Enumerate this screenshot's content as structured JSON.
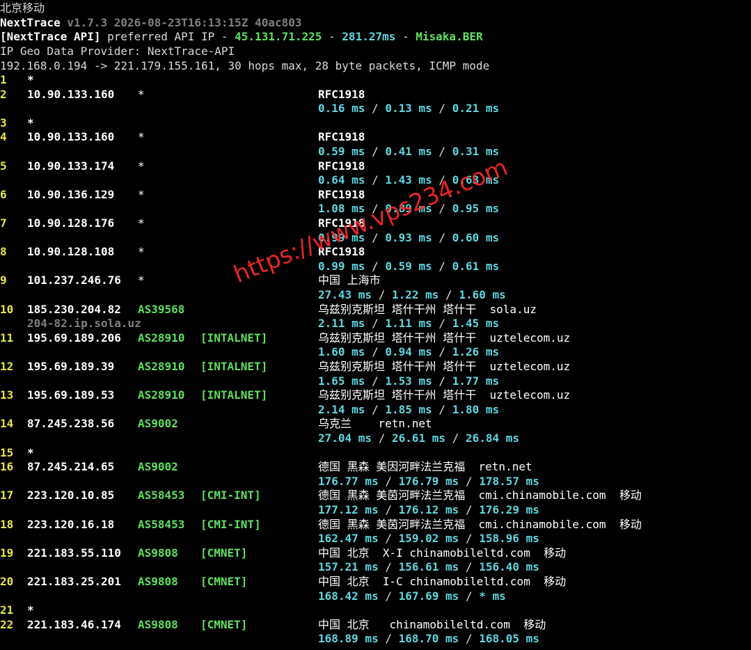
{
  "header": {
    "title_line": "北京移动",
    "app_name": "NextTrace",
    "version": "v1.7.3 2026-08-23T16:13:15Z 40ac803",
    "api_prefix": "[NextTrace API]",
    "api_mid": " preferred API IP - ",
    "api_ip": "45.131.71.225",
    "api_dash1": " - ",
    "api_latency": "281.27ms",
    "api_dash2": " - ",
    "api_node": "Misaka.BER",
    "geo_provider": "IP Geo Data Provider: NextTrace-API",
    "trace_summary": "192.168.0.194 -> 221.179.155.161, 30 hops max, 28 byte packets, ICMP mode"
  },
  "hops": [
    {
      "n": "1",
      "ip": "*"
    },
    {
      "n": "2",
      "ip": "10.90.133.160",
      "asn": "*",
      "geo": "RFC1918",
      "lat": [
        "0.16 ms",
        "0.13 ms",
        "0.21 ms"
      ]
    },
    {
      "n": "3",
      "ip": "*"
    },
    {
      "n": "4",
      "ip": "10.90.133.160",
      "asn": "*",
      "geo": "RFC1918",
      "lat": [
        "0.59 ms",
        "0.41 ms",
        "0.31 ms"
      ]
    },
    {
      "n": "5",
      "ip": "10.90.133.174",
      "asn": "*",
      "geo": "RFC1918",
      "lat": [
        "0.64 ms",
        "1.43 ms",
        "0.63 ms"
      ]
    },
    {
      "n": "6",
      "ip": "10.90.136.129",
      "asn": "*",
      "geo": "RFC1918",
      "lat": [
        "1.08 ms",
        "0.89 ms",
        "0.95 ms"
      ]
    },
    {
      "n": "7",
      "ip": "10.90.128.176",
      "asn": "*",
      "geo": "RFC1918",
      "lat": [
        "0.99 ms",
        "0.93 ms",
        "0.60 ms"
      ]
    },
    {
      "n": "8",
      "ip": "10.90.128.108",
      "asn": "*",
      "geo": "RFC1918",
      "lat": [
        "0.99 ms",
        "0.59 ms",
        "0.61 ms"
      ]
    },
    {
      "n": "9",
      "ip": "101.237.246.76",
      "asn": "*",
      "geo": "中国 上海市",
      "lat": [
        "27.43 ms",
        "1.22 ms",
        "1.60 ms"
      ]
    },
    {
      "n": "10",
      "ip": "185.230.204.82",
      "asn": "AS39568",
      "geo": "乌兹别克斯坦 塔什干州 塔什干  sola.uz",
      "rdns": "204-82.ip.sola.uz",
      "lat": [
        "2.11 ms",
        "1.11 ms",
        "1.45 ms"
      ]
    },
    {
      "n": "11",
      "ip": "195.69.189.206",
      "asn": "AS28910",
      "tag": "[INTALNET]",
      "geo": "乌兹别克斯坦 塔什干州 塔什干  uztelecom.uz",
      "lat": [
        "1.60 ms",
        "0.94 ms",
        "1.26 ms"
      ]
    },
    {
      "n": "12",
      "ip": "195.69.189.39",
      "asn": "AS28910",
      "tag": "[INTALNET]",
      "geo": "乌兹别克斯坦 塔什干州 塔什干  uztelecom.uz",
      "lat": [
        "1.65 ms",
        "1.53 ms",
        "1.77 ms"
      ]
    },
    {
      "n": "13",
      "ip": "195.69.189.53",
      "asn": "AS28910",
      "tag": "[INTALNET]",
      "geo": "乌兹别克斯坦 塔什干州 塔什干  uztelecom.uz",
      "lat": [
        "2.14 ms",
        "1.85 ms",
        "1.80 ms"
      ]
    },
    {
      "n": "14",
      "ip": "87.245.238.56",
      "asn": "AS9002",
      "geo": "乌克兰    retn.net",
      "lat": [
        "27.04 ms",
        "26.61 ms",
        "26.84 ms"
      ]
    },
    {
      "n": "15",
      "ip": "*"
    },
    {
      "n": "16",
      "ip": "87.245.214.65",
      "asn": "AS9002",
      "geo": "德国 黑森 美因河畔法兰克福  retn.net",
      "lat": [
        "176.77 ms",
        "176.79 ms",
        "178.57 ms"
      ]
    },
    {
      "n": "17",
      "ip": "223.120.10.85",
      "asn": "AS58453",
      "tag": "[CMI-INT]",
      "geo": "德国 黑森 美茵河畔法兰克福  cmi.chinamobile.com  移动",
      "lat": [
        "177.12 ms",
        "176.12 ms",
        "176.29 ms"
      ]
    },
    {
      "n": "18",
      "ip": "223.120.16.18",
      "asn": "AS58453",
      "tag": "[CMI-INT]",
      "geo": "德国 黑森 美茵河畔法兰克福  cmi.chinamobile.com  移动",
      "lat": [
        "162.47 ms",
        "159.02 ms",
        "158.96 ms"
      ]
    },
    {
      "n": "19",
      "ip": "221.183.55.110",
      "asn": "AS9808",
      "tag": "[CMNET]",
      "geo": "中国 北京  X-I chinamobileltd.com  移动",
      "lat": [
        "157.21 ms",
        "156.61 ms",
        "156.40 ms"
      ]
    },
    {
      "n": "20",
      "ip": "221.183.25.201",
      "asn": "AS9808",
      "tag": "[CMNET]",
      "geo": "中国 北京  I-C chinamobileltd.com  移动",
      "lat": [
        "168.42 ms",
        "167.69 ms",
        "* ms"
      ]
    },
    {
      "n": "21",
      "ip": "*"
    },
    {
      "n": "22",
      "ip": "221.183.46.174",
      "asn": "AS9808",
      "tag": "[CMNET]",
      "geo": "中国 北京   chinamobileltd.com  移动",
      "lat": [
        "168.89 ms",
        "168.70 ms",
        "168.05 ms"
      ]
    }
  ],
  "watermark": "https://www.vps234.com"
}
